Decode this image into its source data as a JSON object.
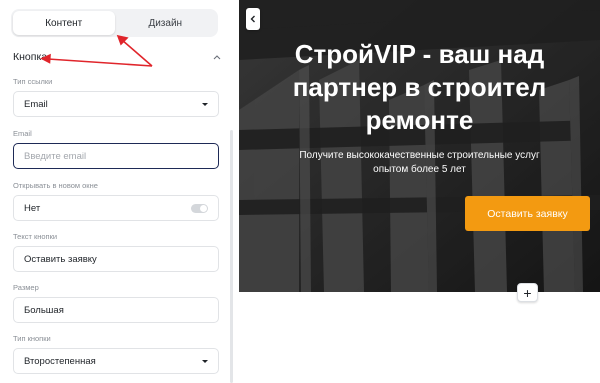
{
  "panel": {
    "tabs": [
      {
        "label": "Контент",
        "active": true
      },
      {
        "label": "Дизайн",
        "active": false
      }
    ],
    "section_title": "Кнопка",
    "fields": {
      "link_type": {
        "label": "Тип ссылки",
        "value": "Email"
      },
      "email": {
        "label": "Email",
        "placeholder": "Введите email",
        "value": ""
      },
      "open_new_window": {
        "label": "Открывать в новом окне",
        "value": "Нет",
        "toggle_on": false
      },
      "button_text": {
        "label": "Текст кнопки",
        "value": "Оставить заявку"
      },
      "size": {
        "label": "Размер",
        "value": "Большая"
      },
      "button_type": {
        "label": "Тип кнопки",
        "value": "Второстепенная"
      }
    }
  },
  "preview": {
    "title_lines": [
      "СтройVIP - ваш над",
      "партнер в строител",
      "ремонте"
    ],
    "subtitle_lines": [
      "Получите высококачественные строительные услуг",
      "опытом более 5 лет"
    ],
    "cta_label": "Оставить заявку",
    "add_button": "+",
    "accent_color": "#f39a11",
    "annotation_color": "#e0252b"
  }
}
